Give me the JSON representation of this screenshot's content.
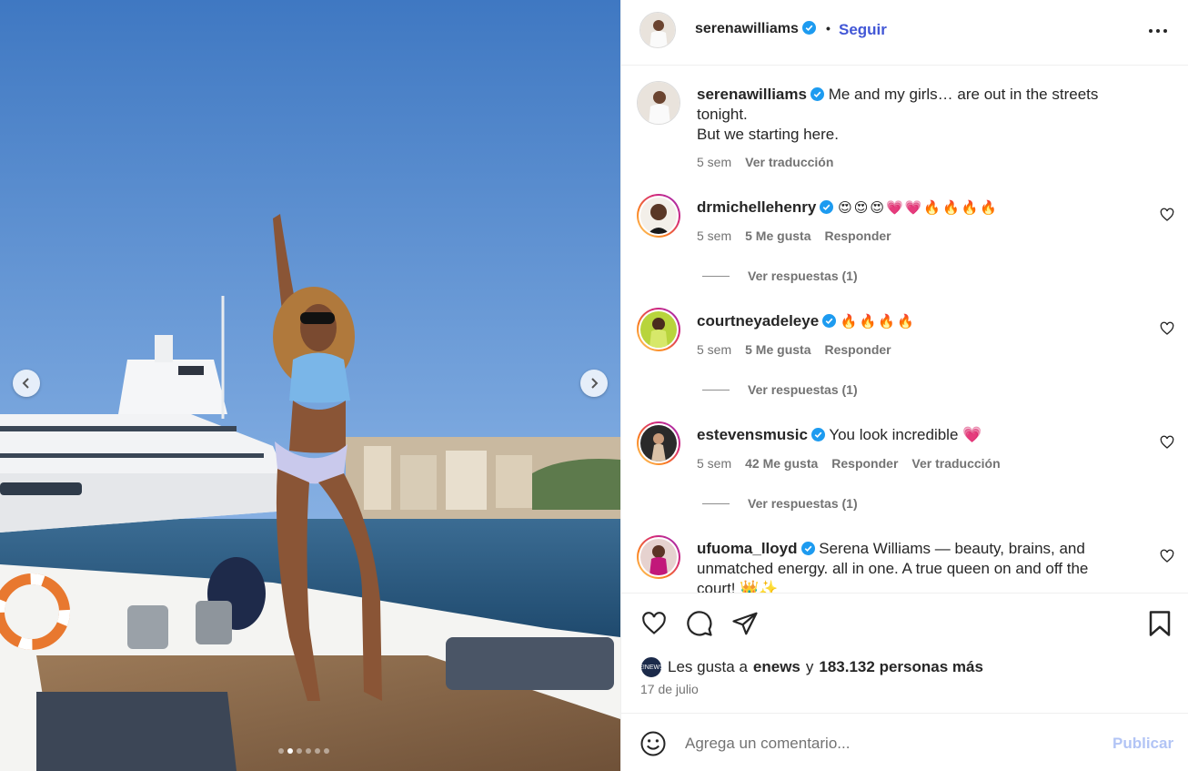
{
  "post": {
    "username": "serenawilliams",
    "follow_label": "Seguir",
    "separator": "•",
    "more_label": "More options"
  },
  "media": {
    "slide_count": 6,
    "active_slide": 2
  },
  "caption": {
    "username": "serenawilliams",
    "line1": "Me and my girls… are out in the streets tonight.",
    "line2": "But we starting here.",
    "time": "5 sem",
    "translate": "Ver traducción"
  },
  "comments": [
    {
      "username": "drmichellehenry",
      "text": "😍😍😍💗💗🔥🔥🔥🔥",
      "time": "5 sem",
      "likes": "5 Me gusta",
      "reply": "Responder",
      "replies": "Ver respuestas (1)"
    },
    {
      "username": "courtneyadeleye",
      "text": "🔥🔥🔥🔥",
      "time": "5 sem",
      "likes": "5 Me gusta",
      "reply": "Responder",
      "replies": "Ver respuestas (1)"
    },
    {
      "username": "estevensmusic",
      "text": "You look incredible 💗",
      "time": "5 sem",
      "likes": "42 Me gusta",
      "reply": "Responder",
      "translate": "Ver traducción",
      "replies": "Ver respuestas (1)"
    },
    {
      "username": "ufuoma_lloyd",
      "text": "Serena Williams — beauty, brains, and unmatched energy. all in one. A true queen on and off the court! 👑✨"
    }
  ],
  "likes": {
    "prefix": "Les gusta a",
    "first_user": "enews",
    "middle": "y",
    "others": "183.132 personas más",
    "avatar_text": "E!NEWS"
  },
  "date": "17 de julio",
  "comment_box": {
    "placeholder": "Agrega un comentario...",
    "publish": "Publicar"
  },
  "colors": {
    "accent": "#4257d6",
    "verified": "#1d9bf0",
    "publish_disabled": "#b2c4f5"
  }
}
